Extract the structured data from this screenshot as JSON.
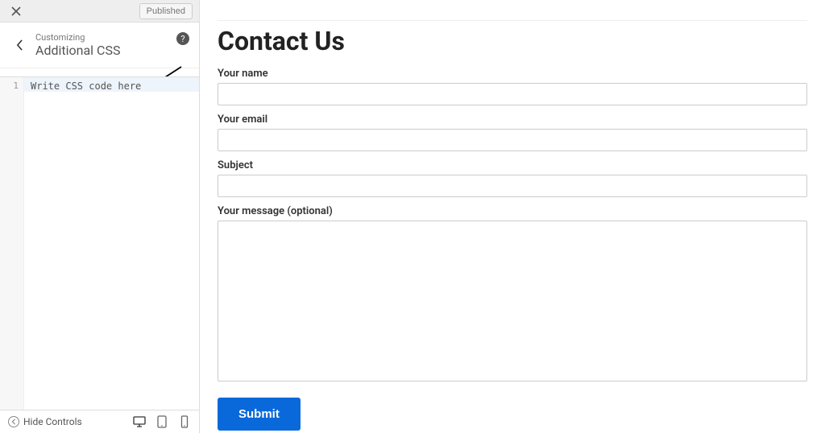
{
  "sidebar": {
    "published_label": "Published",
    "customizing_label": "Customizing",
    "section_title": "Additional CSS",
    "help_glyph": "?",
    "code_line_number": "1",
    "code_placeholder": "Write CSS code here",
    "hide_controls_label": "Hide Controls"
  },
  "preview": {
    "page_title": "Contact Us",
    "form": {
      "name_label": "Your name",
      "email_label": "Your email",
      "subject_label": "Subject",
      "message_label": "Your message (optional)",
      "submit_label": "Submit"
    }
  }
}
